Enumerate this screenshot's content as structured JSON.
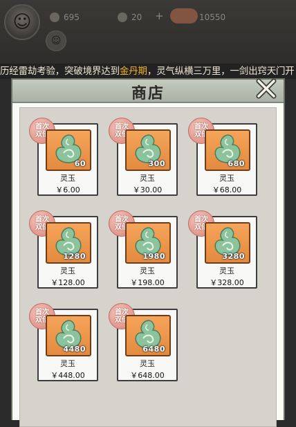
{
  "topbar": {
    "stat_left": "695",
    "stat_mid": "20",
    "stat_plus": "+",
    "stat_right": "10550",
    "avatar_icon": "character-avatar",
    "sub_avatar_icon": "companion-avatar"
  },
  "marquee": {
    "text_before": "历经雷劫考验，突破境界达到",
    "highlight": "金丹期",
    "text_after": "，灵气纵横三万里，一剑出窍天门开"
  },
  "dialog": {
    "title": "商店",
    "close_icon": "close-icon"
  },
  "badge": {
    "line1": "首次",
    "line2": "双倍"
  },
  "items": [
    {
      "amount": "60",
      "name": "灵玉",
      "price": "￥6.00"
    },
    {
      "amount": "300",
      "name": "灵玉",
      "price": "￥30.00"
    },
    {
      "amount": "680",
      "name": "灵玉",
      "price": "￥68.00"
    },
    {
      "amount": "1280",
      "name": "灵玉",
      "price": "￥128.00"
    },
    {
      "amount": "1980",
      "name": "灵玉",
      "price": "￥198.00"
    },
    {
      "amount": "3280",
      "name": "灵玉",
      "price": "￥328.00"
    },
    {
      "amount": "4480",
      "name": "灵玉",
      "price": "￥448.00"
    },
    {
      "amount": "6480",
      "name": "灵玉",
      "price": "￥648.00"
    }
  ],
  "colors": {
    "highlight": "#f1b028",
    "tile": "#e48a3e",
    "gem": "#7fb88f",
    "badge": "#e39d92"
  }
}
